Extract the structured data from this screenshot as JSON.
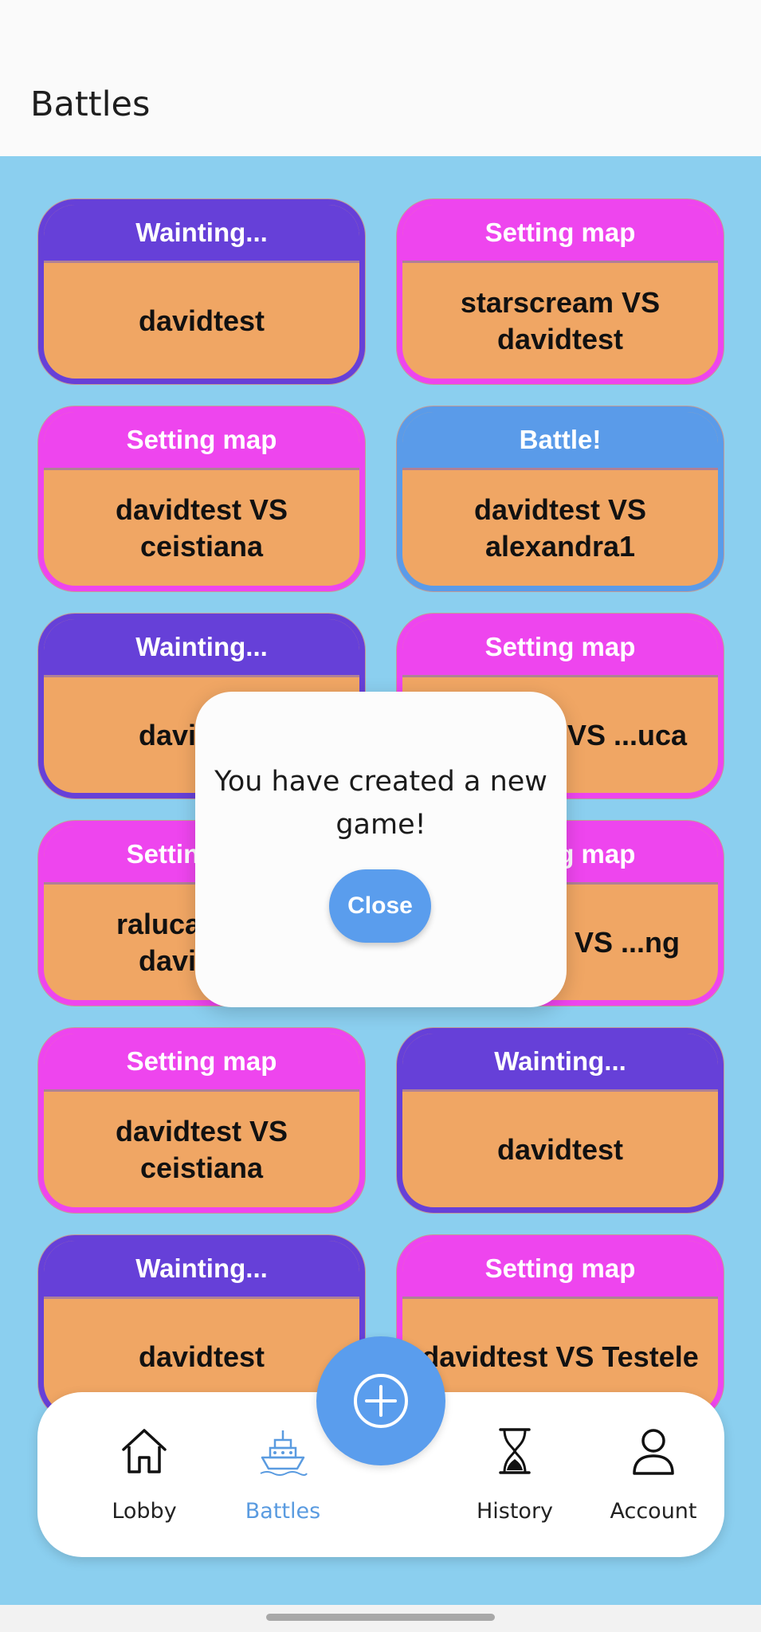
{
  "header": {
    "title": "Battles"
  },
  "battles": [
    {
      "status": "Wainting...",
      "status_type": "waiting",
      "players": "davidtest"
    },
    {
      "status": "Setting map",
      "status_type": "map",
      "players": "starscream VS davidtest"
    },
    {
      "status": "Setting map",
      "status_type": "map",
      "players": "davidtest VS ceistiana"
    },
    {
      "status": "Battle!",
      "status_type": "battle",
      "players": "davidtest VS alexandra1"
    },
    {
      "status": "Wainting...",
      "status_type": "waiting",
      "players": "davidtest"
    },
    {
      "status": "Setting map",
      "status_type": "map",
      "players": "davidtest VS ...uca"
    },
    {
      "status": "Setting map",
      "status_type": "map",
      "players": "ralucaa... VS davidtest"
    },
    {
      "status": "Setting map",
      "status_type": "map",
      "players": "davidtest VS ...ng"
    },
    {
      "status": "Setting map",
      "status_type": "map",
      "players": "davidtest VS ceistiana"
    },
    {
      "status": "Wainting...",
      "status_type": "waiting",
      "players": "davidtest"
    },
    {
      "status": "Wainting...",
      "status_type": "waiting",
      "players": "davidtest"
    },
    {
      "status": "Setting map",
      "status_type": "map",
      "players": "davidtest VS Testele"
    }
  ],
  "dialog": {
    "message": "You have created a new game!",
    "close_label": "Close"
  },
  "fab": {
    "icon": "plus-circle-icon"
  },
  "nav": [
    {
      "label": "Lobby",
      "icon": "home-icon",
      "active": false
    },
    {
      "label": "Battles",
      "icon": "ship-icon",
      "active": true
    },
    {
      "label": "History",
      "icon": "hourglass-icon",
      "active": false
    },
    {
      "label": "Account",
      "icon": "user-icon",
      "active": false
    }
  ],
  "colors": {
    "waiting": "#6640d8",
    "map": "#ee45ee",
    "battle": "#5a9be9",
    "card_body": "#f0a664",
    "background": "#8bcfef",
    "accent": "#5a9ded"
  }
}
